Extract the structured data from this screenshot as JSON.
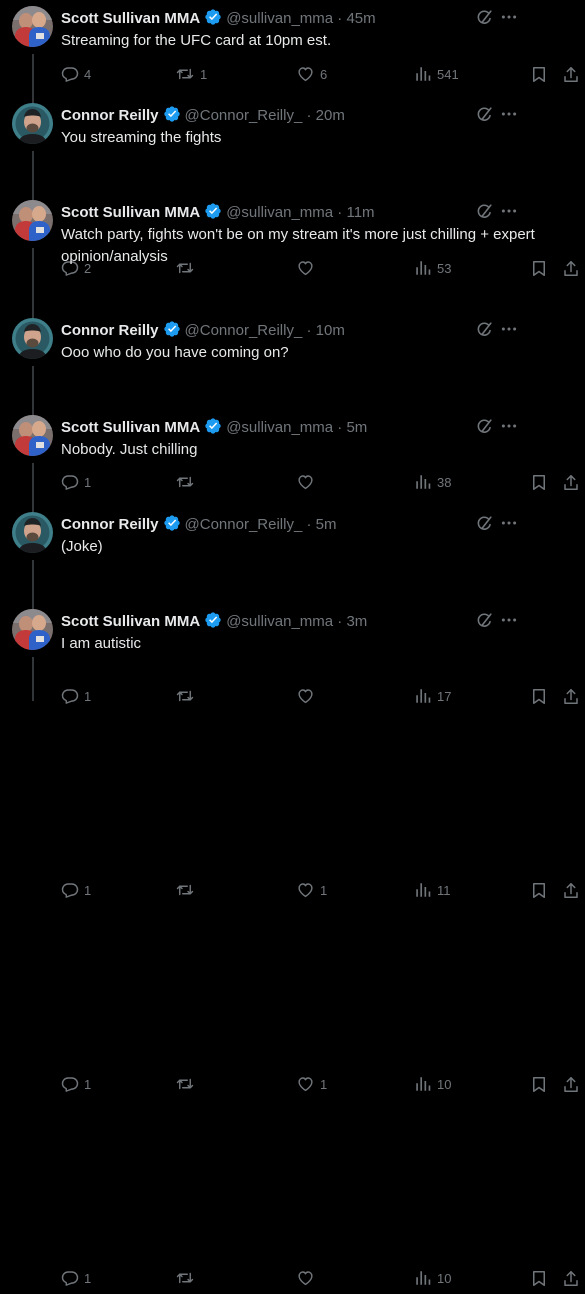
{
  "colors": {
    "background": "#000000",
    "text": "#e7e9ea",
    "muted": "#71767b",
    "verified": "#1d9bf0",
    "thread_line": "#333639"
  },
  "icons": {
    "verified": "verified-badge-icon",
    "reply": "reply-icon",
    "retweet": "retweet-icon",
    "like": "heart-icon",
    "views": "views-icon",
    "bookmark": "bookmark-icon",
    "share": "share-icon",
    "grok": "grok-icon",
    "more": "more-icon"
  },
  "tweets": [
    {
      "name": "Scott Sullivan MMA",
      "handle": "@sullivan_mma",
      "time": "45m",
      "text": "Streaming for the UFC card at 10pm est.",
      "replies": "4",
      "retweets": "1",
      "likes": "6",
      "views": "541"
    },
    {
      "name": "Connor Reilly",
      "handle": "@Connor_Reilly_",
      "time": "20m",
      "text": "You streaming the fights",
      "replies": "2",
      "retweets": "",
      "likes": "",
      "views": "53"
    },
    {
      "name": "Scott Sullivan MMA",
      "handle": "@sullivan_mma",
      "time": "11m",
      "text": "Watch party, fights won't be on my stream it's more just chilling + expert opinion/analysis",
      "replies": "1",
      "retweets": "",
      "likes": "",
      "views": "38"
    },
    {
      "name": "Connor Reilly",
      "handle": "@Connor_Reilly_",
      "time": "10m",
      "text": "Ooo who do you have coming on?",
      "replies": "1",
      "retweets": "",
      "likes": "",
      "views": "17"
    },
    {
      "name": "Scott Sullivan MMA",
      "handle": "@sullivan_mma",
      "time": "5m",
      "text": "Nobody. Just chilling",
      "replies": "1",
      "retweets": "",
      "likes": "1",
      "views": "11"
    },
    {
      "name": "Connor Reilly",
      "handle": "@Connor_Reilly_",
      "time": "5m",
      "text": "(Joke)",
      "replies": "1",
      "retweets": "",
      "likes": "1",
      "views": "10"
    },
    {
      "name": "Scott Sullivan MMA",
      "handle": "@sullivan_mma",
      "time": "3m",
      "text": "I am autistic",
      "replies": "1",
      "retweets": "",
      "likes": "",
      "views": "10"
    }
  ]
}
